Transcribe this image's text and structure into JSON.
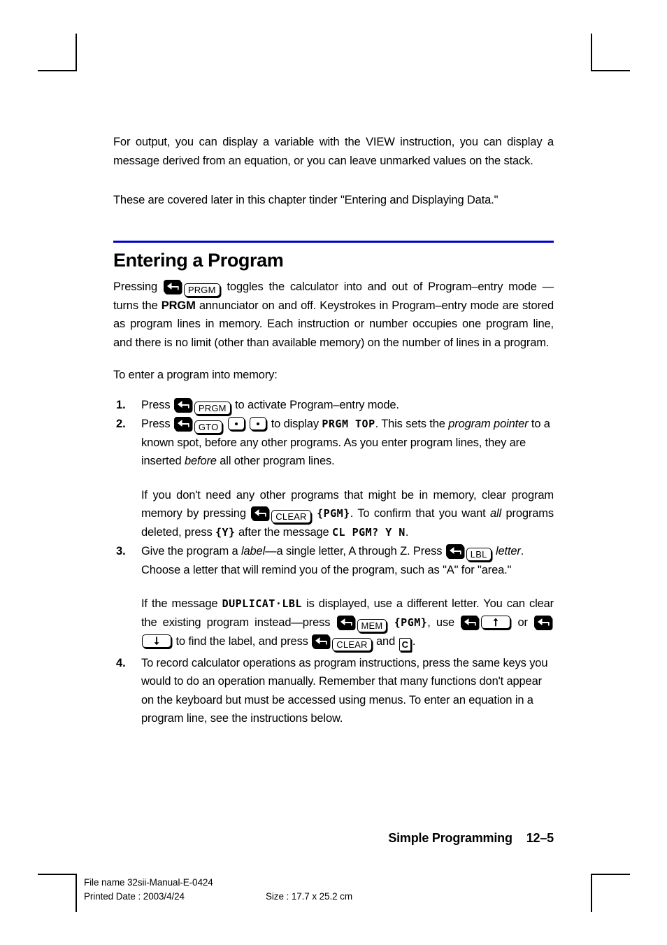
{
  "document": {
    "intro_paragraph_1": "For output, you can display a variable with the VIEW instruction, you can display a message derived from an equation, or you can leave unmarked values on the stack.",
    "intro_paragraph_2": "These are covered later in this chapter tinder \"Entering and Displaying Data.\"",
    "section_heading": "Entering a Program",
    "rule_color": "#0000d0"
  },
  "section_intro": {
    "t1": "Pressing",
    "key_shift": "left-shift-key",
    "key_prgm": "PRGM",
    "t2": "toggles the calculator into and out of Program–entry mode — turns the",
    "annunciator": "PRGM",
    "t3": "annunciator on and off. Keystrokes in Program–entry mode are stored as program lines in memory. Each instruction or number occupies one program line, and there is no limit (other than available memory) on the number of lines in a program."
  },
  "list_intro": "To enter a program into memory:",
  "steps": [
    {
      "num": "1.",
      "t1": "Press",
      "key_a": "left-shift-key",
      "key_b": "PRGM",
      "t2": "to activate Program–entry mode."
    },
    {
      "num": "2.",
      "t1": "Press",
      "key_a": "left-shift-key",
      "key_b": "GTO",
      "key_c": "dot-key",
      "key_d": "dot-key",
      "t2": "to display",
      "lcd1": "PRGM TOP",
      "t3": ". This sets the",
      "em1": "program pointer",
      "t4": "to a known spot, before any other programs. As you enter program lines, they are inserted",
      "em2": "before",
      "t5": "all other program lines.",
      "sub": {
        "s1": "If you don't need any other programs that might be in memory, clear program memory by pressing",
        "key_a": "left-shift-key",
        "key_b": "CLEAR",
        "lcd1": "{PGM}",
        "s2": ". To confirm that you want",
        "em1": "all",
        "s3": "programs deleted, press",
        "lcd2": "{Y}",
        "s4": "after the message",
        "lcd3": "CL PGM? Y N",
        "s5": "."
      }
    },
    {
      "num": "3.",
      "t1": "Give the program a",
      "em1": "label",
      "t2": "—a single letter, A through Z. Press",
      "key_a": "left-shift-key",
      "key_b": "LBL",
      "em2": "letter",
      "t3": ". Choose a letter that will remind you of the program, such as \"A\" for \"area.\"",
      "sub": {
        "s1": "If the message",
        "lcd1": "DUPLICAT·LBL",
        "s2": "is displayed, use a different letter. You can clear the existing program instead—press",
        "key_a": "left-shift-key",
        "key_b": "MEM",
        "lcd2": "{PGM}",
        "s3": ", use",
        "key_c": "left-shift-key",
        "key_d": "up-arrow-key",
        "s4": "or",
        "key_e": "left-shift-key",
        "key_f": "down-arrow-key",
        "s5": "to find the label, and press",
        "key_g": "left-shift-key",
        "key_h": "CLEAR",
        "s6": "and",
        "key_i": "C",
        "s7": "."
      }
    },
    {
      "num": "4.",
      "t1": "To record calculator operations as program instructions, press the same keys you would to do an operation manually. Remember that many functions don't appear on the keyboard but must be accessed using menus. To enter an equation in a program line, see the instructions below."
    }
  ],
  "page_footer": {
    "chapter_title": "Simple Programming",
    "page_number": "12–5"
  },
  "doc_footer": {
    "file_name": "File name 32sii-Manual-E-0424",
    "printed_date": "Printed Date : 2003/4/24",
    "size": "Size : 17.7 x 25.2 cm"
  }
}
